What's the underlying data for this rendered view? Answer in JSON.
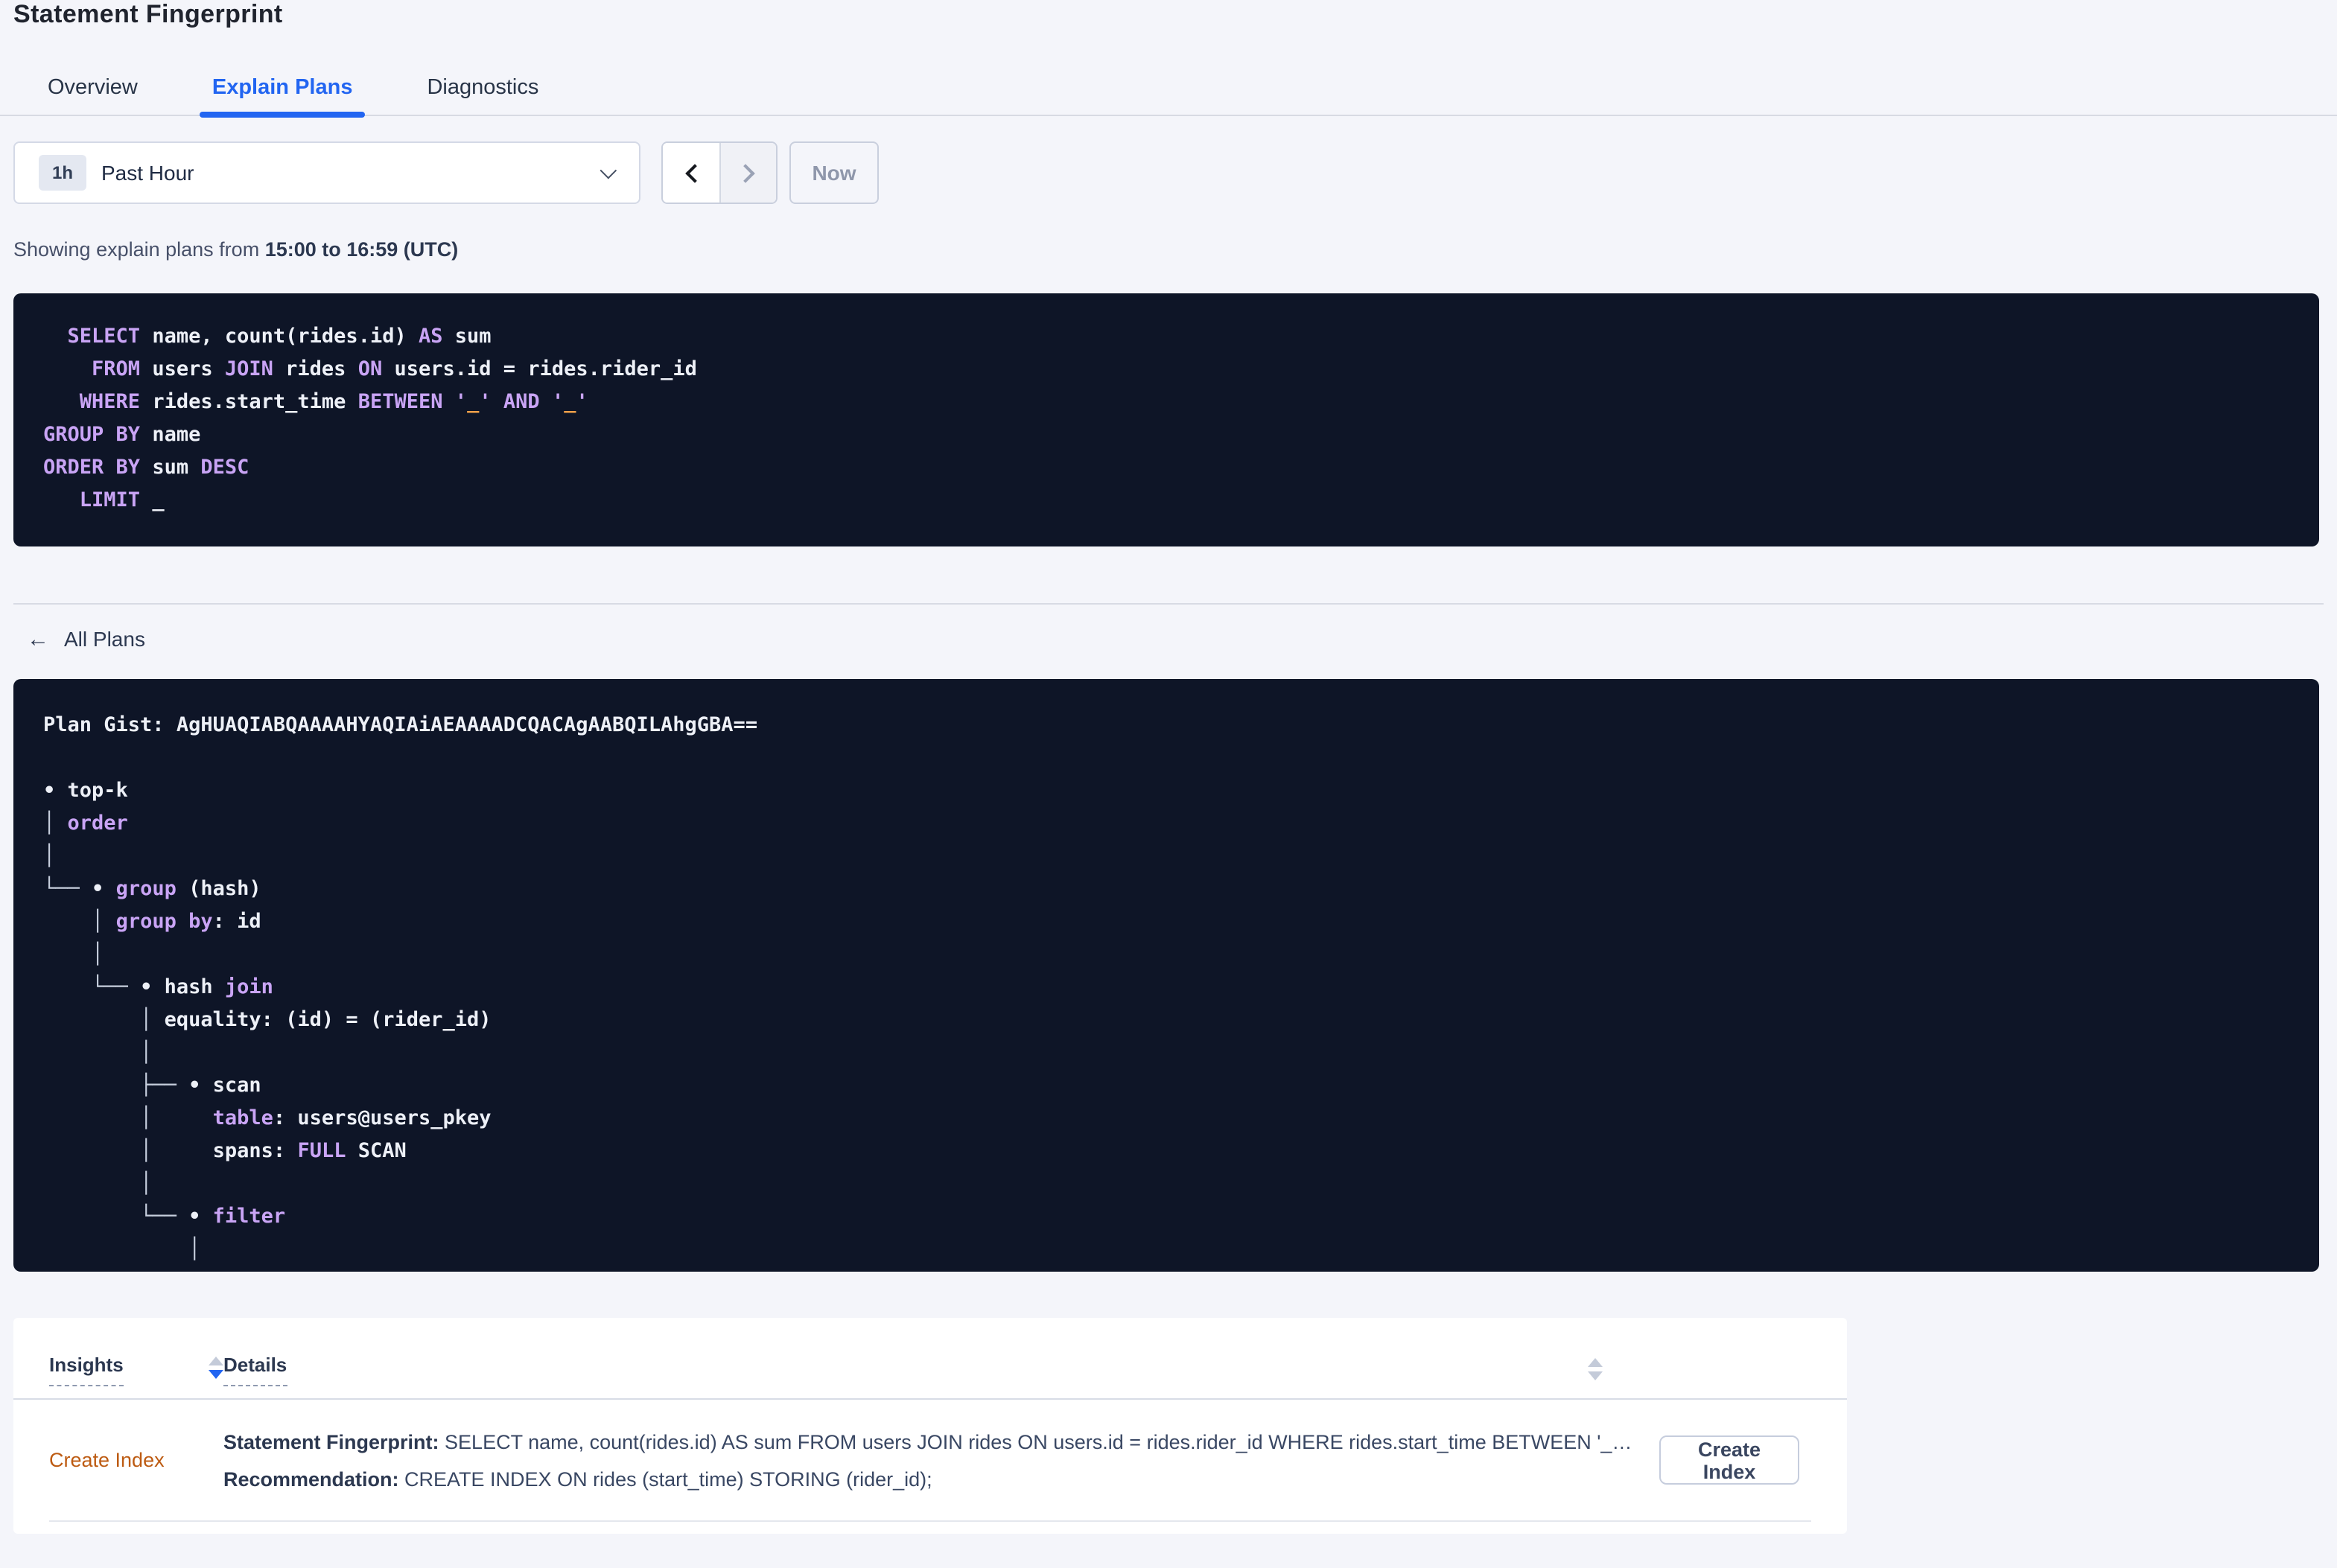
{
  "page": {
    "title": "Statement Fingerprint"
  },
  "colors": {
    "accent_blue": "#2265f1",
    "code_background": "#0e1527",
    "code_keyword": "#c9a4f5",
    "code_plain": "#edf0f7",
    "code_placeholder": "#efa04a",
    "insight_link": "#bd5b12",
    "page_background": "#f4f5fa"
  },
  "icons": {
    "back_arrow": "←"
  },
  "tabs": [
    {
      "label": "Overview",
      "active": false
    },
    {
      "label": "Explain Plans",
      "active": true
    },
    {
      "label": "Diagnostics",
      "active": false
    }
  ],
  "time_picker": {
    "badge": "1h",
    "label": "Past Hour",
    "now_label": "Now"
  },
  "status_line": {
    "prefix": "Showing explain plans from ",
    "range": "15:00 to 16:59 (UTC)"
  },
  "sql": {
    "lines": [
      [
        {
          "c": "pl",
          "t": "  "
        },
        {
          "c": "kw",
          "t": "SELECT"
        },
        {
          "c": "pl",
          "t": " name, count(rides.id) "
        },
        {
          "c": "kw",
          "t": "AS"
        },
        {
          "c": "pl",
          "t": " sum"
        }
      ],
      [
        {
          "c": "pl",
          "t": "    "
        },
        {
          "c": "kw",
          "t": "FROM"
        },
        {
          "c": "pl",
          "t": " users "
        },
        {
          "c": "kw",
          "t": "JOIN"
        },
        {
          "c": "pl",
          "t": " rides "
        },
        {
          "c": "kw",
          "t": "ON"
        },
        {
          "c": "pl",
          "t": " users.id = rides.rider_id"
        }
      ],
      [
        {
          "c": "pl",
          "t": "   "
        },
        {
          "c": "kw",
          "t": "WHERE"
        },
        {
          "c": "pl",
          "t": " rides.start_time "
        },
        {
          "c": "kw",
          "t": "BETWEEN"
        },
        {
          "c": "pl",
          "t": " "
        },
        {
          "c": "str",
          "t": "'"
        },
        {
          "c": "ph",
          "t": "_"
        },
        {
          "c": "str",
          "t": "'"
        },
        {
          "c": "pl",
          "t": " "
        },
        {
          "c": "kw",
          "t": "AND"
        },
        {
          "c": "pl",
          "t": " "
        },
        {
          "c": "str",
          "t": "'"
        },
        {
          "c": "ph",
          "t": "_"
        },
        {
          "c": "str",
          "t": "'"
        }
      ],
      [
        {
          "c": "kw",
          "t": "GROUP BY"
        },
        {
          "c": "pl",
          "t": " name"
        }
      ],
      [
        {
          "c": "kw",
          "t": "ORDER BY"
        },
        {
          "c": "pl",
          "t": " sum "
        },
        {
          "c": "kw",
          "t": "DESC"
        }
      ],
      [
        {
          "c": "pl",
          "t": "   "
        },
        {
          "c": "kw",
          "t": "LIMIT"
        },
        {
          "c": "pl",
          "t": " _"
        }
      ]
    ]
  },
  "back_link": {
    "label": "All Plans"
  },
  "plan": {
    "gist_label": "Plan Gist: ",
    "gist": "AgHUAQIABQAAAAHYAQIAiAEAAAADCQACAgAABQILAhgGBA==",
    "tree": [
      [
        {
          "c": "pl",
          "t": "• top-k"
        }
      ],
      [
        {
          "c": "tree",
          "t": "│ "
        },
        {
          "c": "kw",
          "t": "order"
        }
      ],
      [
        {
          "c": "tree",
          "t": "│"
        }
      ],
      [
        {
          "c": "tree",
          "t": "└── "
        },
        {
          "c": "pl",
          "t": "• "
        },
        {
          "c": "kw",
          "t": "group"
        },
        {
          "c": "pl",
          "t": " (hash)"
        }
      ],
      [
        {
          "c": "pl",
          "t": "    "
        },
        {
          "c": "tree",
          "t": "│ "
        },
        {
          "c": "kw",
          "t": "group by"
        },
        {
          "c": "pl",
          "t": ": id"
        }
      ],
      [
        {
          "c": "pl",
          "t": "    "
        },
        {
          "c": "tree",
          "t": "│"
        }
      ],
      [
        {
          "c": "pl",
          "t": "    "
        },
        {
          "c": "tree",
          "t": "└── "
        },
        {
          "c": "pl",
          "t": "• hash "
        },
        {
          "c": "kw",
          "t": "join"
        }
      ],
      [
        {
          "c": "pl",
          "t": "        "
        },
        {
          "c": "tree",
          "t": "│ "
        },
        {
          "c": "pl",
          "t": "equality: (id) = (rider_id)"
        }
      ],
      [
        {
          "c": "pl",
          "t": "        "
        },
        {
          "c": "tree",
          "t": "│"
        }
      ],
      [
        {
          "c": "pl",
          "t": "        "
        },
        {
          "c": "tree",
          "t": "├── "
        },
        {
          "c": "pl",
          "t": "• scan"
        }
      ],
      [
        {
          "c": "pl",
          "t": "        "
        },
        {
          "c": "tree",
          "t": "│     "
        },
        {
          "c": "kw",
          "t": "table"
        },
        {
          "c": "pl",
          "t": ": users@users_pkey"
        }
      ],
      [
        {
          "c": "pl",
          "t": "        "
        },
        {
          "c": "tree",
          "t": "│     "
        },
        {
          "c": "pl",
          "t": "spans: "
        },
        {
          "c": "kw",
          "t": "FULL"
        },
        {
          "c": "pl",
          "t": " SCAN"
        }
      ],
      [
        {
          "c": "pl",
          "t": "        "
        },
        {
          "c": "tree",
          "t": "│"
        }
      ],
      [
        {
          "c": "pl",
          "t": "        "
        },
        {
          "c": "tree",
          "t": "└── "
        },
        {
          "c": "pl",
          "t": "• "
        },
        {
          "c": "kw",
          "t": "filter"
        }
      ],
      [
        {
          "c": "pl",
          "t": "            "
        },
        {
          "c": "tree",
          "t": "│"
        }
      ]
    ]
  },
  "insights_table": {
    "columns": [
      {
        "label": "Insights"
      },
      {
        "label": "Details"
      }
    ],
    "rows": [
      {
        "insight": "Create Index",
        "details": [
          {
            "label": "Statement Fingerprint:",
            "text": " SELECT name, count(rides.id) AS sum FROM users JOIN rides ON users.id = rides.rider_id WHERE rides.start_time BETWEEN '_…"
          },
          {
            "label": "Recommendation:",
            "text": " CREATE INDEX ON rides (start_time) STORING (rider_id);"
          }
        ],
        "action": "Create Index"
      }
    ]
  }
}
